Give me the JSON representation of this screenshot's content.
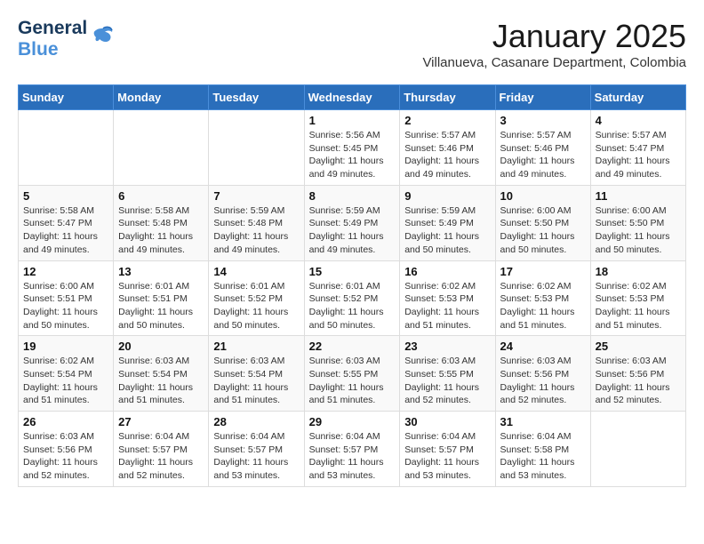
{
  "logo": {
    "line1": "General",
    "line2": "Blue"
  },
  "title": "January 2025",
  "location": "Villanueva, Casanare Department, Colombia",
  "weekdays": [
    "Sunday",
    "Monday",
    "Tuesday",
    "Wednesday",
    "Thursday",
    "Friday",
    "Saturday"
  ],
  "weeks": [
    [
      {
        "day": "",
        "info": ""
      },
      {
        "day": "",
        "info": ""
      },
      {
        "day": "",
        "info": ""
      },
      {
        "day": "1",
        "info": "Sunrise: 5:56 AM\nSunset: 5:45 PM\nDaylight: 11 hours and 49 minutes."
      },
      {
        "day": "2",
        "info": "Sunrise: 5:57 AM\nSunset: 5:46 PM\nDaylight: 11 hours and 49 minutes."
      },
      {
        "day": "3",
        "info": "Sunrise: 5:57 AM\nSunset: 5:46 PM\nDaylight: 11 hours and 49 minutes."
      },
      {
        "day": "4",
        "info": "Sunrise: 5:57 AM\nSunset: 5:47 PM\nDaylight: 11 hours and 49 minutes."
      }
    ],
    [
      {
        "day": "5",
        "info": "Sunrise: 5:58 AM\nSunset: 5:47 PM\nDaylight: 11 hours and 49 minutes."
      },
      {
        "day": "6",
        "info": "Sunrise: 5:58 AM\nSunset: 5:48 PM\nDaylight: 11 hours and 49 minutes."
      },
      {
        "day": "7",
        "info": "Sunrise: 5:59 AM\nSunset: 5:48 PM\nDaylight: 11 hours and 49 minutes."
      },
      {
        "day": "8",
        "info": "Sunrise: 5:59 AM\nSunset: 5:49 PM\nDaylight: 11 hours and 49 minutes."
      },
      {
        "day": "9",
        "info": "Sunrise: 5:59 AM\nSunset: 5:49 PM\nDaylight: 11 hours and 50 minutes."
      },
      {
        "day": "10",
        "info": "Sunrise: 6:00 AM\nSunset: 5:50 PM\nDaylight: 11 hours and 50 minutes."
      },
      {
        "day": "11",
        "info": "Sunrise: 6:00 AM\nSunset: 5:50 PM\nDaylight: 11 hours and 50 minutes."
      }
    ],
    [
      {
        "day": "12",
        "info": "Sunrise: 6:00 AM\nSunset: 5:51 PM\nDaylight: 11 hours and 50 minutes."
      },
      {
        "day": "13",
        "info": "Sunrise: 6:01 AM\nSunset: 5:51 PM\nDaylight: 11 hours and 50 minutes."
      },
      {
        "day": "14",
        "info": "Sunrise: 6:01 AM\nSunset: 5:52 PM\nDaylight: 11 hours and 50 minutes."
      },
      {
        "day": "15",
        "info": "Sunrise: 6:01 AM\nSunset: 5:52 PM\nDaylight: 11 hours and 50 minutes."
      },
      {
        "day": "16",
        "info": "Sunrise: 6:02 AM\nSunset: 5:53 PM\nDaylight: 11 hours and 51 minutes."
      },
      {
        "day": "17",
        "info": "Sunrise: 6:02 AM\nSunset: 5:53 PM\nDaylight: 11 hours and 51 minutes."
      },
      {
        "day": "18",
        "info": "Sunrise: 6:02 AM\nSunset: 5:53 PM\nDaylight: 11 hours and 51 minutes."
      }
    ],
    [
      {
        "day": "19",
        "info": "Sunrise: 6:02 AM\nSunset: 5:54 PM\nDaylight: 11 hours and 51 minutes."
      },
      {
        "day": "20",
        "info": "Sunrise: 6:03 AM\nSunset: 5:54 PM\nDaylight: 11 hours and 51 minutes."
      },
      {
        "day": "21",
        "info": "Sunrise: 6:03 AM\nSunset: 5:54 PM\nDaylight: 11 hours and 51 minutes."
      },
      {
        "day": "22",
        "info": "Sunrise: 6:03 AM\nSunset: 5:55 PM\nDaylight: 11 hours and 51 minutes."
      },
      {
        "day": "23",
        "info": "Sunrise: 6:03 AM\nSunset: 5:55 PM\nDaylight: 11 hours and 52 minutes."
      },
      {
        "day": "24",
        "info": "Sunrise: 6:03 AM\nSunset: 5:56 PM\nDaylight: 11 hours and 52 minutes."
      },
      {
        "day": "25",
        "info": "Sunrise: 6:03 AM\nSunset: 5:56 PM\nDaylight: 11 hours and 52 minutes."
      }
    ],
    [
      {
        "day": "26",
        "info": "Sunrise: 6:03 AM\nSunset: 5:56 PM\nDaylight: 11 hours and 52 minutes."
      },
      {
        "day": "27",
        "info": "Sunrise: 6:04 AM\nSunset: 5:57 PM\nDaylight: 11 hours and 52 minutes."
      },
      {
        "day": "28",
        "info": "Sunrise: 6:04 AM\nSunset: 5:57 PM\nDaylight: 11 hours and 53 minutes."
      },
      {
        "day": "29",
        "info": "Sunrise: 6:04 AM\nSunset: 5:57 PM\nDaylight: 11 hours and 53 minutes."
      },
      {
        "day": "30",
        "info": "Sunrise: 6:04 AM\nSunset: 5:57 PM\nDaylight: 11 hours and 53 minutes."
      },
      {
        "day": "31",
        "info": "Sunrise: 6:04 AM\nSunset: 5:58 PM\nDaylight: 11 hours and 53 minutes."
      },
      {
        "day": "",
        "info": ""
      }
    ]
  ]
}
